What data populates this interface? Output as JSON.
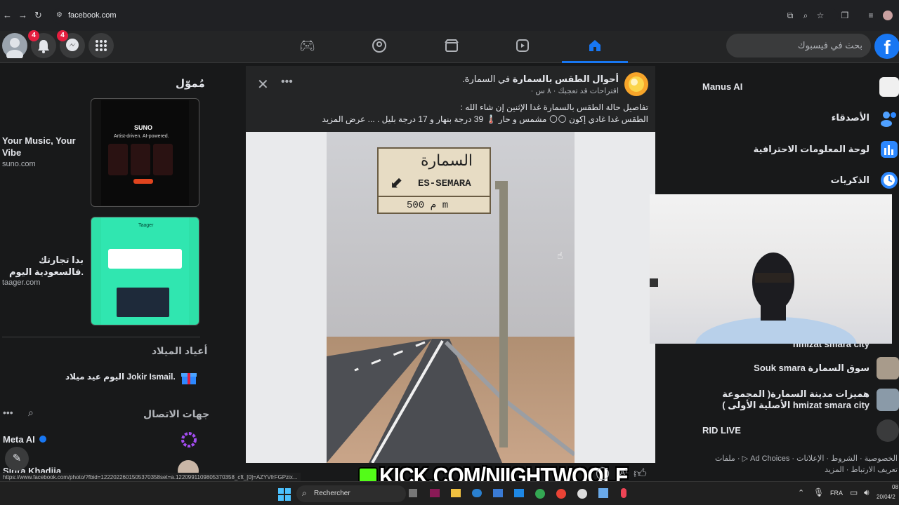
{
  "browser": {
    "url": "facebook.com"
  },
  "topbar": {
    "notif_badge": "4",
    "messenger_badge": "4",
    "search_placeholder": "بحث في فيسبوك"
  },
  "left": {
    "sponsored_title": "مُموّل",
    "ad1_title": "Your Music, Your Vibe",
    "ad1_domain": "suno.com",
    "ad1_brand": "SUNO",
    "ad1_tagline": "Artist-driven. AI-powered.",
    "ad2_title": "بدا تجارتك فالسعودية اليوم.",
    "ad2_domain": "taager.com",
    "ad2_brand": "Taager",
    "birthdays_title": "أعياد الميلاد",
    "birthday_text": "اليوم عيد ميلاد Jokir Ismail.",
    "contacts_title": "جهات الاتصال",
    "contact1": "Meta AI",
    "contact2": "Sidra Khadija"
  },
  "post": {
    "page_name": "أحوال الطقس بالسمارة",
    "in_label": "في السمارة.",
    "meta": "اقتراحات قد تعجبك · ٨ س ·",
    "line1": "تفاصيل حالة الطقس بالسمارة غدا الإثنين إن شاء الله :",
    "line2": "الطقس غدا غادي إكون 🌕🌕 مشمس و حار 🌡️ 39 درجة بنهار و 17 درجة بليل . ... عرض المزيد",
    "sign_arabic": "السمارة",
    "sign_latin": "ES-SEMARA",
    "sign_distance": "م  500 m"
  },
  "right": {
    "items": [
      {
        "label": "Manus AI"
      },
      {
        "label": "الأصدقاء"
      },
      {
        "label": "لوحة المعلومات الاحترافية"
      },
      {
        "label": "الذكريات"
      }
    ],
    "groups": [
      {
        "label": "hmizat smara city"
      },
      {
        "label": "Souk smara سوق السمارة"
      },
      {
        "label": "هميزات مدينة السمارة( المجموعة الأصلية الأولى ) hmizat smara city"
      },
      {
        "label": "RID LIVE"
      }
    ],
    "footer": "الخصوصية · الشروط · الإعلانات · Ad Choices ▷ · ملفات تعريف الارتباط · المزيد"
  },
  "overlay": {
    "kick": "KICK.COM/NIIGHTWOOLF"
  },
  "status_url": "https://www.facebook.com/photo/?fbid=1222022601505370358set=a.1220991109805370358_cft_[0]=AZYVfrFGPzix...",
  "taskbar": {
    "search": "Rechercher",
    "lang": "FRA",
    "time": "08",
    "date": "20/04/2"
  },
  "colors": {
    "fb_blue": "#1877f2",
    "bg": "#18191a",
    "card": "#242526",
    "kick_green": "#53fc18"
  }
}
